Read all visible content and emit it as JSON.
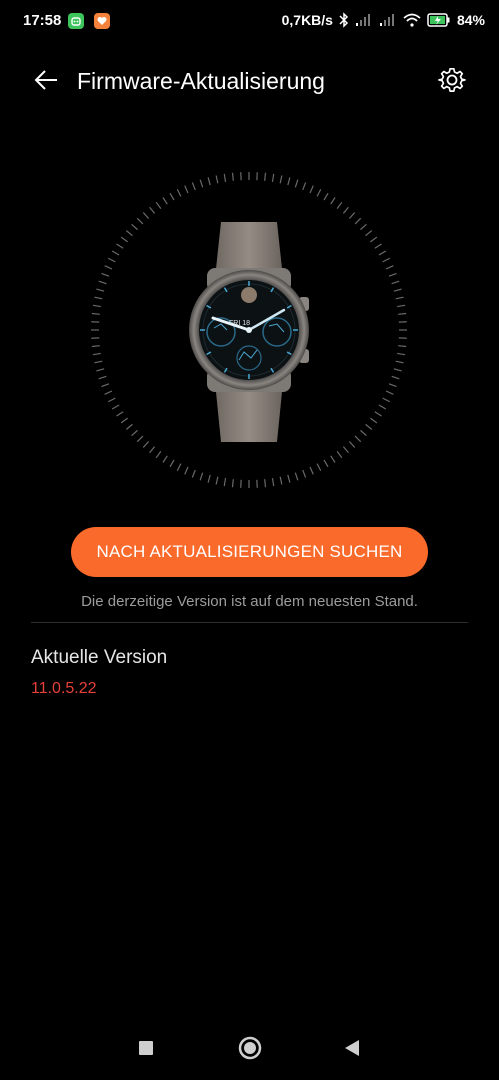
{
  "status_bar": {
    "time": "17:58",
    "network_speed": "0,7KB/s",
    "battery_percent": "84%",
    "icons": [
      "app-notification-green-icon",
      "app-notification-orange-icon",
      "bluetooth-icon",
      "signal-icon",
      "signal-icon",
      "wifi-icon",
      "battery-charging-icon"
    ]
  },
  "app_bar": {
    "title": "Firmware-Aktualisierung",
    "back_icon": "arrow-left-icon",
    "settings_icon": "gear-icon"
  },
  "watch": {
    "face_date": "FRI 18",
    "icon": "smartwatch-illustration"
  },
  "actions": {
    "check_updates_label": "NACH AKTUALISIERUNGEN SUCHEN",
    "status_message": "Die derzeitige Version ist auf dem neuesten Stand."
  },
  "version": {
    "label": "Aktuelle Version",
    "value": "11.0.5.22"
  },
  "nav_bar": {
    "icons": [
      "recents-square-icon",
      "home-circle-icon",
      "back-triangle-icon"
    ]
  },
  "colors": {
    "accent": "#f96a2b",
    "version_value": "#e6403a",
    "background": "#000000"
  }
}
